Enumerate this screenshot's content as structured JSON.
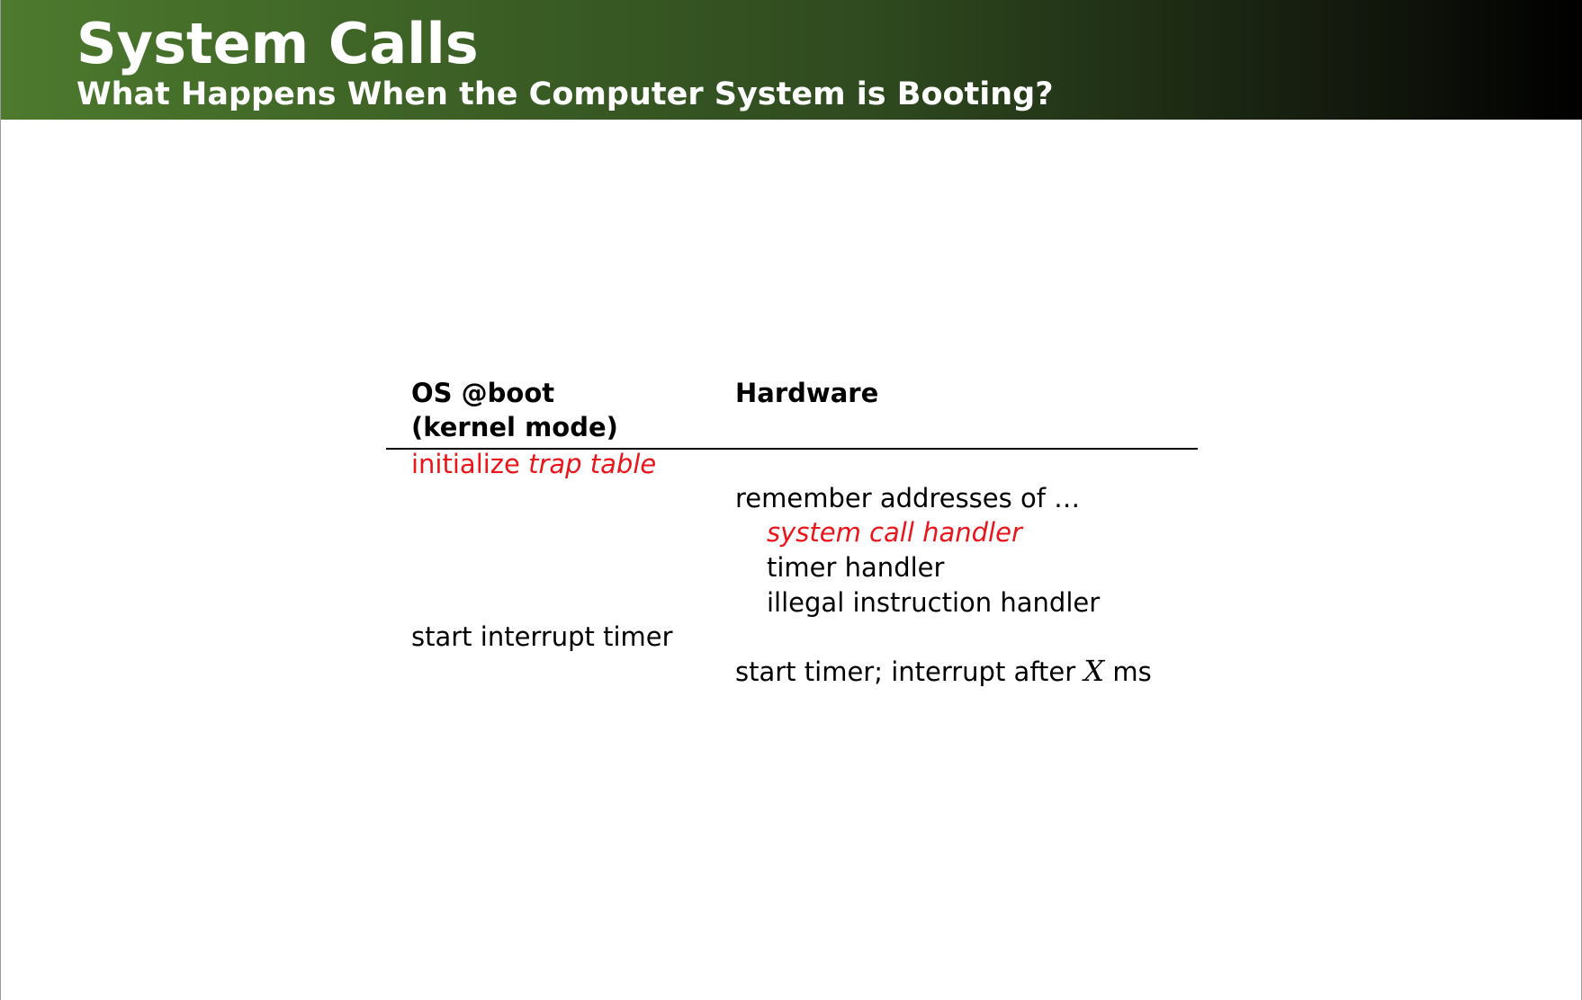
{
  "slide": {
    "title": "System Calls",
    "subtitle": "What Happens When the Computer System is Booting?"
  },
  "table": {
    "headers": {
      "os_line1": "OS @boot",
      "os_line2": "(kernel mode)",
      "hardware": "Hardware"
    },
    "rows": {
      "init_prefix": "initialize ",
      "init_emphasis": "trap table",
      "remember": "remember addresses of …",
      "syscall_handler": "system call handler",
      "timer_handler": "timer handler",
      "illegal_handler": "illegal instruction handler",
      "start_interrupt": "start interrupt timer",
      "start_timer_prefix": "start timer; interrupt after ",
      "start_timer_var": "X",
      "start_timer_suffix": " ms"
    }
  },
  "colors": {
    "highlight": "#e8151b",
    "header_start": "#4d7a2e",
    "header_end": "#000000"
  }
}
